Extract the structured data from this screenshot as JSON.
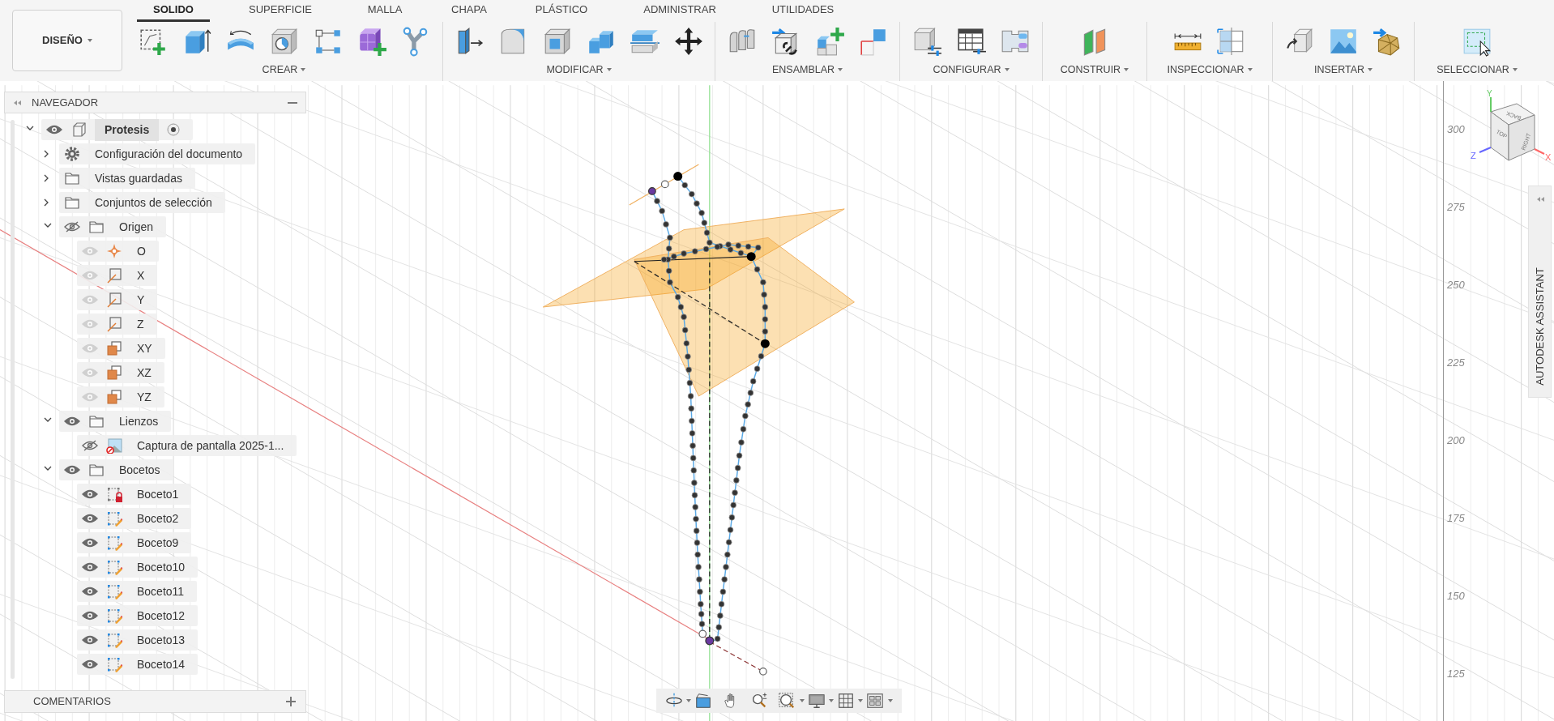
{
  "toolbar": {
    "workspace": "DISEÑO",
    "tabs": [
      {
        "label": "SOLIDO",
        "selected": true
      },
      {
        "label": "SUPERFICIE",
        "selected": false
      },
      {
        "label": "MALLA",
        "selected": false
      },
      {
        "label": "CHAPA",
        "selected": false
      },
      {
        "label": "PLÁSTICO",
        "selected": false
      },
      {
        "label": "ADMINISTRAR",
        "selected": false
      },
      {
        "label": "UTILIDADES",
        "selected": false
      }
    ],
    "groups": [
      {
        "label": "CREAR"
      },
      {
        "label": "MODIFICAR"
      },
      {
        "label": "ENSAMBLAR"
      },
      {
        "label": "CONFIGURAR"
      },
      {
        "label": "CONSTRUIR"
      },
      {
        "label": "INSPECCIONAR"
      },
      {
        "label": "INSERTAR"
      },
      {
        "label": "SELECCIONAR"
      }
    ]
  },
  "navigator": {
    "title": "NAVEGADOR",
    "tree": [
      {
        "label": "Protesis",
        "kind": "component",
        "visible": true,
        "expanded": true,
        "active": true,
        "children": [
          {
            "label": "Configuración del documento",
            "kind": "gear",
            "expanded": false
          },
          {
            "label": "Vistas guardadas",
            "kind": "folder",
            "expanded": false
          },
          {
            "label": "Conjuntos de selección",
            "kind": "folder",
            "expanded": false
          },
          {
            "label": "Origen",
            "kind": "folder",
            "visible": false,
            "expanded": true,
            "children": [
              {
                "label": "O",
                "kind": "point",
                "visible": true,
                "dimmed": true
              },
              {
                "label": "X",
                "kind": "axis",
                "visible": true,
                "dimmed": true
              },
              {
                "label": "Y",
                "kind": "axis",
                "visible": true,
                "dimmed": true
              },
              {
                "label": "Z",
                "kind": "axis",
                "visible": true,
                "dimmed": true
              },
              {
                "label": "XY",
                "kind": "plane",
                "visible": true,
                "dimmed": true
              },
              {
                "label": "XZ",
                "kind": "plane",
                "visible": true,
                "dimmed": true
              },
              {
                "label": "YZ",
                "kind": "plane",
                "visible": true,
                "dimmed": true
              }
            ]
          },
          {
            "label": "Lienzos",
            "kind": "folder",
            "visible": true,
            "expanded": true,
            "children": [
              {
                "label": "Captura de pantalla 2025-1...",
                "kind": "canvas",
                "visible": false
              }
            ]
          },
          {
            "label": "Bocetos",
            "kind": "folder",
            "visible": true,
            "expanded": true,
            "children": [
              {
                "label": "Boceto1",
                "kind": "sketch-locked",
                "visible": true
              },
              {
                "label": "Boceto2",
                "kind": "sketch",
                "visible": true
              },
              {
                "label": "Boceto9",
                "kind": "sketch",
                "visible": true
              },
              {
                "label": "Boceto10",
                "kind": "sketch",
                "visible": true
              },
              {
                "label": "Boceto11",
                "kind": "sketch",
                "visible": true
              },
              {
                "label": "Boceto12",
                "kind": "sketch",
                "visible": true
              },
              {
                "label": "Boceto13",
                "kind": "sketch",
                "visible": true
              },
              {
                "label": "Boceto14",
                "kind": "sketch",
                "visible": true
              }
            ]
          }
        ]
      }
    ]
  },
  "comments": {
    "title": "COMENTARIOS"
  },
  "ruler_labels": [
    "300",
    "275",
    "250",
    "225",
    "200",
    "175",
    "150",
    "125"
  ],
  "viewcube": {
    "top": "TOP",
    "back": "BACK",
    "right": "RIGHT",
    "x_axis": "X",
    "y_axis": "Y",
    "z_axis": "Z"
  },
  "assistant": {
    "title": "AUTODESK ASSISTANT"
  }
}
